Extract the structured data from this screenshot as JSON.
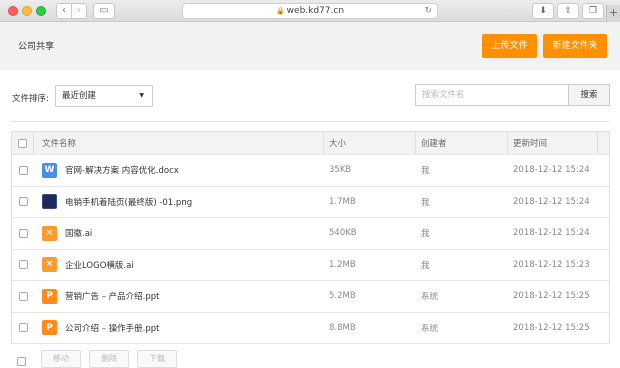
{
  "browser": {
    "url": "web.kd77.cn",
    "nav_back": "‹",
    "nav_forward": "›"
  },
  "header": {
    "title": "公司共享",
    "upload_label": "上传文件",
    "new_folder_label": "新建文件夹"
  },
  "toolbar": {
    "sort_label": "文件排序:",
    "sort_value": "最近创建",
    "search_placeholder": "搜索文件名",
    "search_button": "搜索"
  },
  "table": {
    "columns": [
      "文件名称",
      "大小",
      "创建者",
      "更新时间"
    ],
    "rows": [
      {
        "icon": "word-file-icon",
        "type": "word",
        "glyph": "W",
        "name": "官网-解决方案 内容优化.docx",
        "size": "35KB",
        "creator": "我",
        "time": "2018-12-12 15:24"
      },
      {
        "icon": "image-file-icon",
        "type": "img",
        "glyph": "",
        "name": "电销手机着陆页(最终版) -01.png",
        "size": "1.7MB",
        "creator": "我",
        "time": "2018-12-12 15:24"
      },
      {
        "icon": "ai-file-icon",
        "type": "ai",
        "glyph": "✕",
        "name": "国徽.ai",
        "size": "540KB",
        "creator": "我",
        "time": "2018-12-12 15:24"
      },
      {
        "icon": "ai-file-icon",
        "type": "ai",
        "glyph": "✕",
        "name": "企业LOGO横版.ai",
        "size": "1.2MB",
        "creator": "我",
        "time": "2018-12-12 15:23"
      },
      {
        "icon": "ppt-file-icon",
        "type": "ppt",
        "glyph": "P",
        "name": "营销广告 – 产品介绍.ppt",
        "size": "5.2MB",
        "creator": "系统",
        "time": "2018-12-12 15:25"
      },
      {
        "icon": "ppt-file-icon",
        "type": "ppt",
        "glyph": "P",
        "name": "公司介绍 – 操作手册.ppt",
        "size": "8.8MB",
        "creator": "系统",
        "time": "2018-12-12 15:25"
      }
    ]
  },
  "footer": {
    "buttons": [
      "移动",
      "删除",
      "下载"
    ]
  },
  "colors": {
    "accent": "#ff9000",
    "word": "#4a90e2",
    "ppt": "#ff8c1a"
  }
}
